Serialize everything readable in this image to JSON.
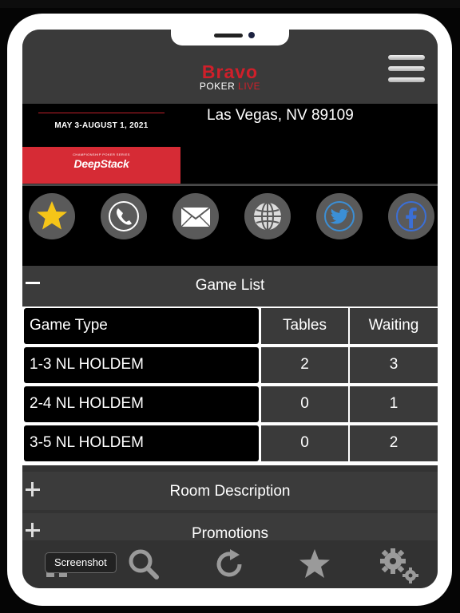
{
  "header": {
    "logo_brand": "Bravo",
    "logo_sub": "POKER",
    "logo_live": "LIVE",
    "menu_icon": "hamburger-menu-icon"
  },
  "banner": {
    "flyer_dates": "MAY 3-AUGUST 1, 2021",
    "flyer_series": "CHAMPIONSHIP POKER SERIES",
    "flyer_brand": "DeepStack",
    "address": "Las Vegas, NV 89109"
  },
  "actions": [
    {
      "icon": "star-icon",
      "color": "#f5c518"
    },
    {
      "icon": "phone-icon"
    },
    {
      "icon": "mail-icon"
    },
    {
      "icon": "globe-icon"
    },
    {
      "icon": "twitter-icon",
      "color": "#3b8fd6"
    },
    {
      "icon": "facebook-icon",
      "color": "#3b6fd6"
    }
  ],
  "game_list": {
    "title": "Game List",
    "columns": [
      "Game Type",
      "Tables",
      "Waiting"
    ],
    "rows": [
      {
        "game": "1-3 NL HOLDEM",
        "tables": "2",
        "waiting": "3"
      },
      {
        "game": "2-4 NL HOLDEM",
        "tables": "0",
        "waiting": "1"
      },
      {
        "game": "3-5 NL HOLDEM",
        "tables": "0",
        "waiting": "2"
      }
    ]
  },
  "sections": {
    "room_description": "Room Description",
    "promotions": "Promotions"
  },
  "bottom_nav": {
    "items": [
      "home-icon",
      "search-icon",
      "refresh-icon",
      "star-icon",
      "settings-gears-icon"
    ],
    "tooltip": "Screenshot"
  }
}
